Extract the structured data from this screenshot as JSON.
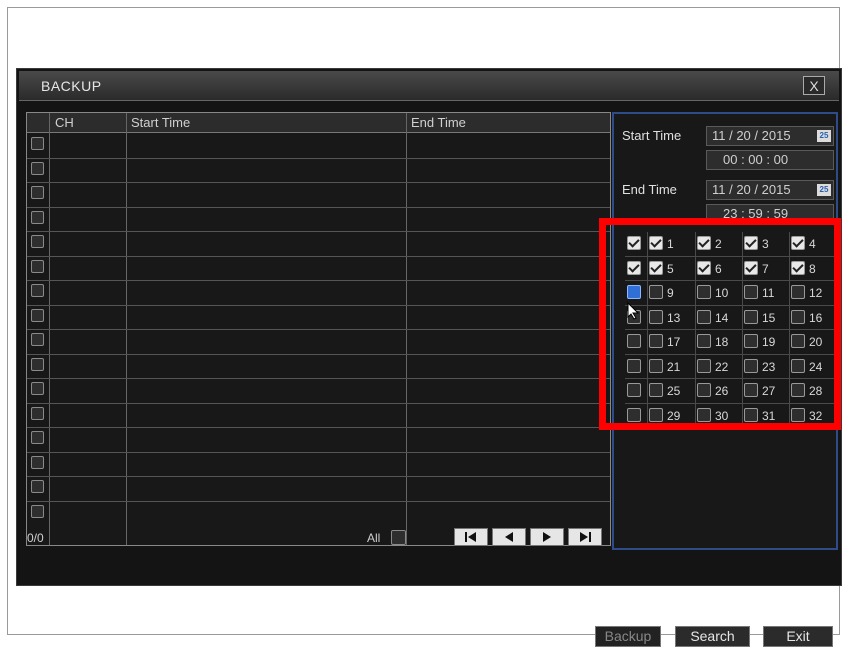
{
  "dialog": {
    "title": "BACKUP",
    "close_label": "X"
  },
  "table": {
    "headers": [
      "CH",
      "Start Time",
      "End Time"
    ],
    "row_count": 16,
    "count_label": "0/0",
    "all_label": "All"
  },
  "search_panel": {
    "start_time_label": "Start Time",
    "start_date": "11 / 20 / 2015",
    "start_clock": "00  :  00  :  00",
    "end_time_label": "End Time",
    "end_date": "11 / 20 / 2015",
    "end_clock": "23  :  59  :  59",
    "calendar_icon_text": "25"
  },
  "channels": [
    {
      "num": "1",
      "checked": true
    },
    {
      "num": "2",
      "checked": true
    },
    {
      "num": "3",
      "checked": true
    },
    {
      "num": "4",
      "checked": true
    },
    {
      "num": "5",
      "checked": true
    },
    {
      "num": "6",
      "checked": true
    },
    {
      "num": "7",
      "checked": true
    },
    {
      "num": "8",
      "checked": true
    },
    {
      "num": "9",
      "checked": false
    },
    {
      "num": "10",
      "checked": false
    },
    {
      "num": "11",
      "checked": false
    },
    {
      "num": "12",
      "checked": false
    },
    {
      "num": "13",
      "checked": false
    },
    {
      "num": "14",
      "checked": false
    },
    {
      "num": "15",
      "checked": false
    },
    {
      "num": "16",
      "checked": false
    },
    {
      "num": "17",
      "checked": false
    },
    {
      "num": "18",
      "checked": false
    },
    {
      "num": "19",
      "checked": false
    },
    {
      "num": "20",
      "checked": false
    },
    {
      "num": "21",
      "checked": false
    },
    {
      "num": "22",
      "checked": false
    },
    {
      "num": "23",
      "checked": false
    },
    {
      "num": "24",
      "checked": false
    },
    {
      "num": "25",
      "checked": false
    },
    {
      "num": "26",
      "checked": false
    },
    {
      "num": "27",
      "checked": false
    },
    {
      "num": "28",
      "checked": false
    },
    {
      "num": "29",
      "checked": false
    },
    {
      "num": "30",
      "checked": false
    },
    {
      "num": "31",
      "checked": false
    },
    {
      "num": "32",
      "checked": false
    }
  ],
  "row_select_all": [
    true,
    true,
    false,
    false,
    false,
    false,
    false,
    false
  ],
  "buttons": {
    "backup": "Backup",
    "search": "Search",
    "exit": "Exit"
  },
  "colors": {
    "highlight_box": "#ff0000",
    "panel_border": "#2e4c8a",
    "focus_checkbox": "#2f6fd6"
  }
}
